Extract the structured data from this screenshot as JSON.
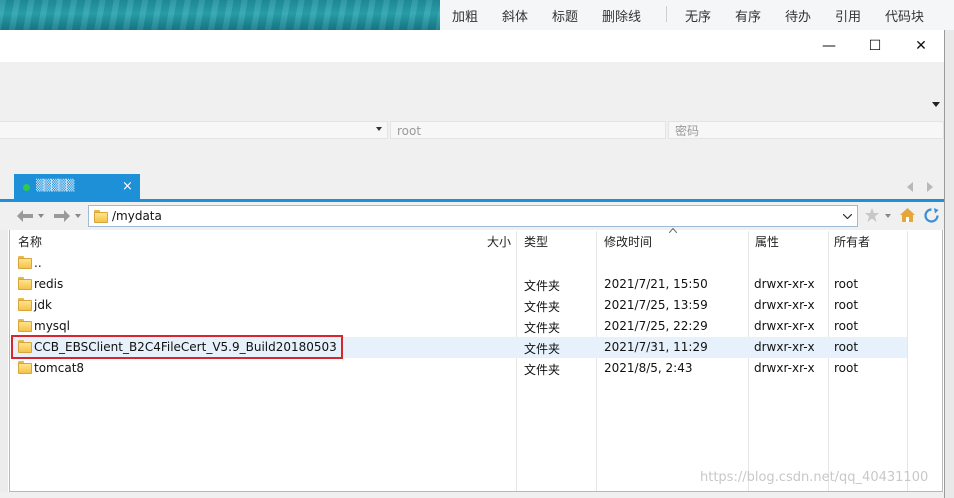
{
  "editor_toolbar": {
    "items": [
      "加粗",
      "斜体",
      "标题",
      "删除线",
      "无序",
      "有序",
      "待办",
      "引用",
      "代码块"
    ]
  },
  "window": {
    "minimize_glyph": "—",
    "maximize_glyph": "☐",
    "close_glyph": "✕"
  },
  "session": {
    "username": "root",
    "password_placeholder": "密码",
    "tab_label": "▒▒▒▒▒",
    "tab_close": "×"
  },
  "navigation": {
    "path": "/mydata"
  },
  "file_list": {
    "columns": {
      "name": "名称",
      "size": "大小",
      "type": "类型",
      "modified": "修改时间",
      "attributes": "属性",
      "owner": "所有者"
    },
    "rows": [
      {
        "name": "..",
        "size": "",
        "type": "",
        "modified": "",
        "attributes": "",
        "owner": ""
      },
      {
        "name": "redis",
        "size": "",
        "type": "文件夹",
        "modified": "2021/7/21, 15:50",
        "attributes": "drwxr-xr-x",
        "owner": "root"
      },
      {
        "name": "jdk",
        "size": "",
        "type": "文件夹",
        "modified": "2021/7/25, 13:59",
        "attributes": "drwxr-xr-x",
        "owner": "root"
      },
      {
        "name": "mysql",
        "size": "",
        "type": "文件夹",
        "modified": "2021/7/25, 22:29",
        "attributes": "drwxr-xr-x",
        "owner": "root"
      },
      {
        "name": "CCB_EBSClient_B2C4FileCert_V5.9_Build20180503",
        "size": "",
        "type": "文件夹",
        "modified": "2021/7/31, 11:29",
        "attributes": "drwxr-xr-x",
        "owner": "root"
      },
      {
        "name": "tomcat8",
        "size": "",
        "type": "文件夹",
        "modified": "2021/8/5, 2:43",
        "attributes": "drwxr-xr-x",
        "owner": "root"
      }
    ]
  },
  "watermark": "https://blog.csdn.net/qq_40431100",
  "colors": {
    "accent": "#1e90d8",
    "highlight_border": "#d8262f",
    "selected_row": "#e6f1fb"
  }
}
